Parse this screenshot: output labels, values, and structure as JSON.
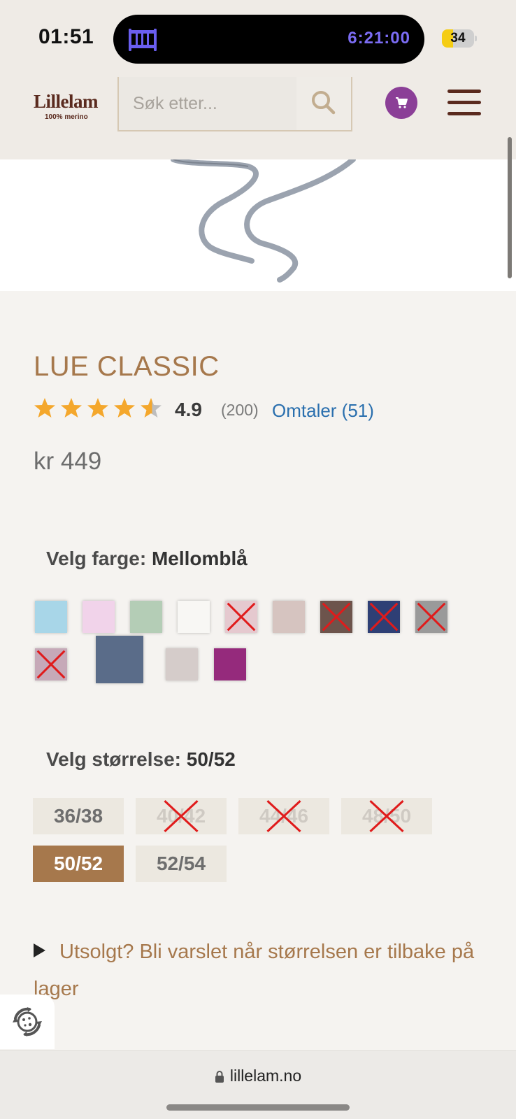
{
  "status_bar": {
    "time": "01:51",
    "timer": "6:21:00",
    "battery_level": "34",
    "battery_fraction": 0.34,
    "icons": [
      "crib-icon",
      "battery-icon"
    ]
  },
  "header": {
    "logo_name": "Lillelam",
    "logo_tagline": "100% merino",
    "search_placeholder": "Søk etter...",
    "icons": [
      "search-icon",
      "cart-icon",
      "hamburger-menu-icon"
    ],
    "colors": {
      "logo": "#5a2a1e",
      "cart_bg": "#8b3f97"
    }
  },
  "product": {
    "title": "LUE CLASSIC",
    "rating": "4.9",
    "rating_value": 4.9,
    "rating_count": "(200)",
    "reviews_link": "Omtaler (51)",
    "price": "kr 449",
    "color_label": "Velg farge:",
    "color_selected": "Mellomblå",
    "colors": [
      {
        "hex": "#a8d6e8",
        "available": true,
        "selected": false
      },
      {
        "hex": "#f1d3ea",
        "available": true,
        "selected": false
      },
      {
        "hex": "#b4cdb6",
        "available": true,
        "selected": false
      },
      {
        "hex": "#f8f7f4",
        "available": true,
        "selected": false
      },
      {
        "hex": "#e5c9cf",
        "available": false,
        "selected": false
      },
      {
        "hex": "#d6c4c0",
        "available": true,
        "selected": false
      },
      {
        "hex": "#6d544c",
        "available": false,
        "selected": false
      },
      {
        "hex": "#2e3f75",
        "available": false,
        "selected": false
      },
      {
        "hex": "#9a9a9a",
        "available": false,
        "selected": false
      },
      {
        "hex": "#c6a9b8",
        "available": false,
        "selected": false
      },
      {
        "hex": "#5a6c89",
        "available": true,
        "selected": true
      },
      {
        "hex": "#d5ccca",
        "available": true,
        "selected": false
      },
      {
        "hex": "#952a7c",
        "available": true,
        "selected": false
      }
    ],
    "size_label": "Velg størrelse:",
    "size_selected": "50/52",
    "sizes": [
      {
        "label": "36/38",
        "available": true,
        "selected": false
      },
      {
        "label": "40/42",
        "available": false,
        "selected": false
      },
      {
        "label": "44/46",
        "available": false,
        "selected": false
      },
      {
        "label": "48/50",
        "available": false,
        "selected": false
      },
      {
        "label": "50/52",
        "available": true,
        "selected": true
      },
      {
        "label": "52/54",
        "available": true,
        "selected": false
      }
    ],
    "notify_text": "Utsolgt? Bli varslet når størrelsen er tilbake på lager"
  },
  "browser": {
    "url": "lillelam.no",
    "icons": [
      "lock-icon"
    ]
  },
  "widget": {
    "icon": "recycle-badge-icon"
  }
}
